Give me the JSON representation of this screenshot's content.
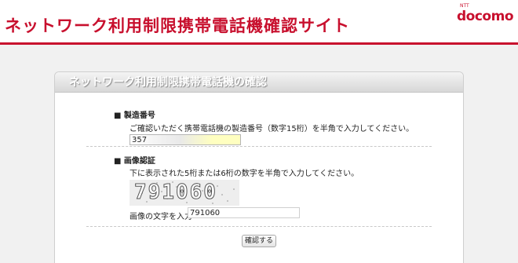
{
  "header": {
    "site_title": "ネットワーク利用制限携帯電話機確認サイト",
    "logo_sub": "NTT",
    "logo_main": "docomo"
  },
  "panel": {
    "title": "ネットワーク利用制限携帯電話機の確認"
  },
  "serial_section": {
    "label": "■ 製造番号",
    "description": "ご確認いただく携帯電話機の製造番号（数字15桁）を半角で入力してください。",
    "input_value": "357"
  },
  "captcha_section": {
    "label": "■ 画像認証",
    "description": "下に表示された5桁または6桁の数字を半角で入力してください。",
    "captcha_text": "791060",
    "input_label": "画像の文字を入力",
    "input_value": "791060"
  },
  "actions": {
    "confirm_label": "確認する"
  },
  "colors": {
    "brand": "#c8102e",
    "input_highlight": "#ffffc0"
  }
}
